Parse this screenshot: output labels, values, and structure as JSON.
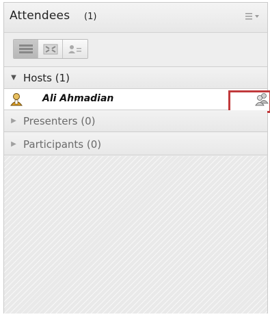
{
  "pod": {
    "title": "Attendees",
    "count": "(1)",
    "menu_icon": "options-menu-icon"
  },
  "toolbar": {
    "views": [
      {
        "icon": "list-view-icon",
        "active": true
      },
      {
        "icon": "fullscreen-view-icon",
        "active": false
      },
      {
        "icon": "attendee-status-view-icon",
        "active": false
      }
    ]
  },
  "sections": {
    "hosts": {
      "label": "Hosts (1)",
      "expanded": true
    },
    "presenters": {
      "label": "Presenters (0)",
      "expanded": false
    },
    "participants": {
      "label": "Participants (0)",
      "expanded": false
    }
  },
  "attendees": [
    {
      "name": "Ali Ahmadian",
      "role": "host",
      "avatar": "host-avatar-icon",
      "role_icon": "host-role-icon"
    }
  ],
  "colors": {
    "highlight": "#c0393b",
    "avatar": "#e0a020"
  }
}
